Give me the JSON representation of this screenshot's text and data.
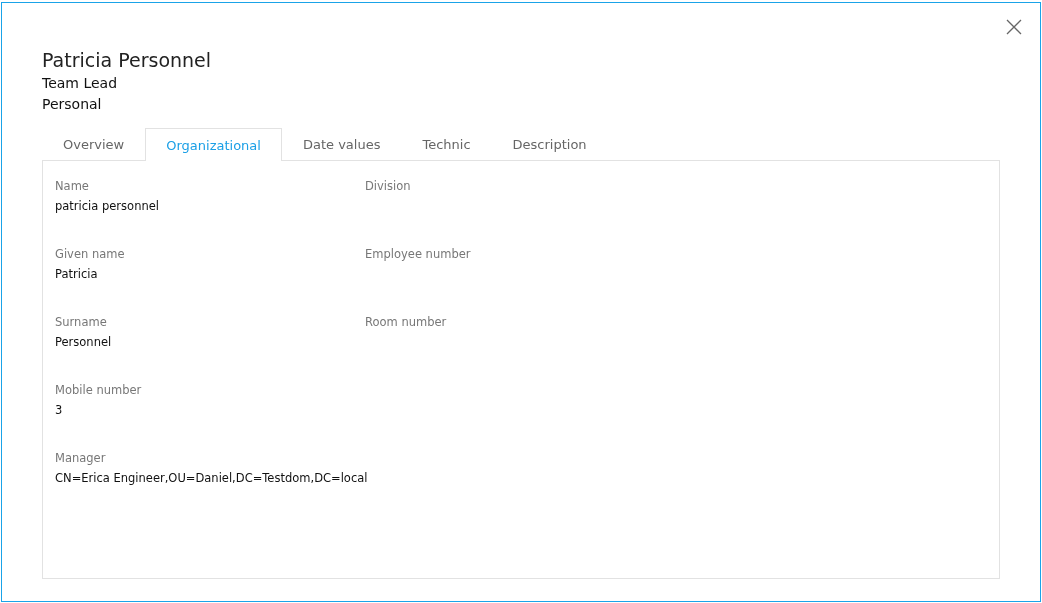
{
  "header": {
    "name": "Patricia Personnel",
    "role": "Team Lead",
    "category": "Personal"
  },
  "tabs": [
    {
      "label": "Overview",
      "selected": false
    },
    {
      "label": "Organizational",
      "selected": true
    },
    {
      "label": "Date values",
      "selected": false
    },
    {
      "label": "Technic",
      "selected": false
    },
    {
      "label": "Description",
      "selected": false
    }
  ],
  "columns": [
    [
      {
        "label": "Name",
        "value": "patricia personnel"
      },
      {
        "label": "Given name",
        "value": "Patricia"
      },
      {
        "label": "Surname",
        "value": "Personnel"
      },
      {
        "label": "Mobile number",
        "value": "3"
      },
      {
        "label": "Manager",
        "value": "CN=Erica Engineer,OU=Daniel,DC=Testdom,DC=local"
      }
    ],
    [
      {
        "label": "Division"
      },
      {
        "label": "Employee number"
      },
      {
        "label": "Room number"
      }
    ]
  ]
}
